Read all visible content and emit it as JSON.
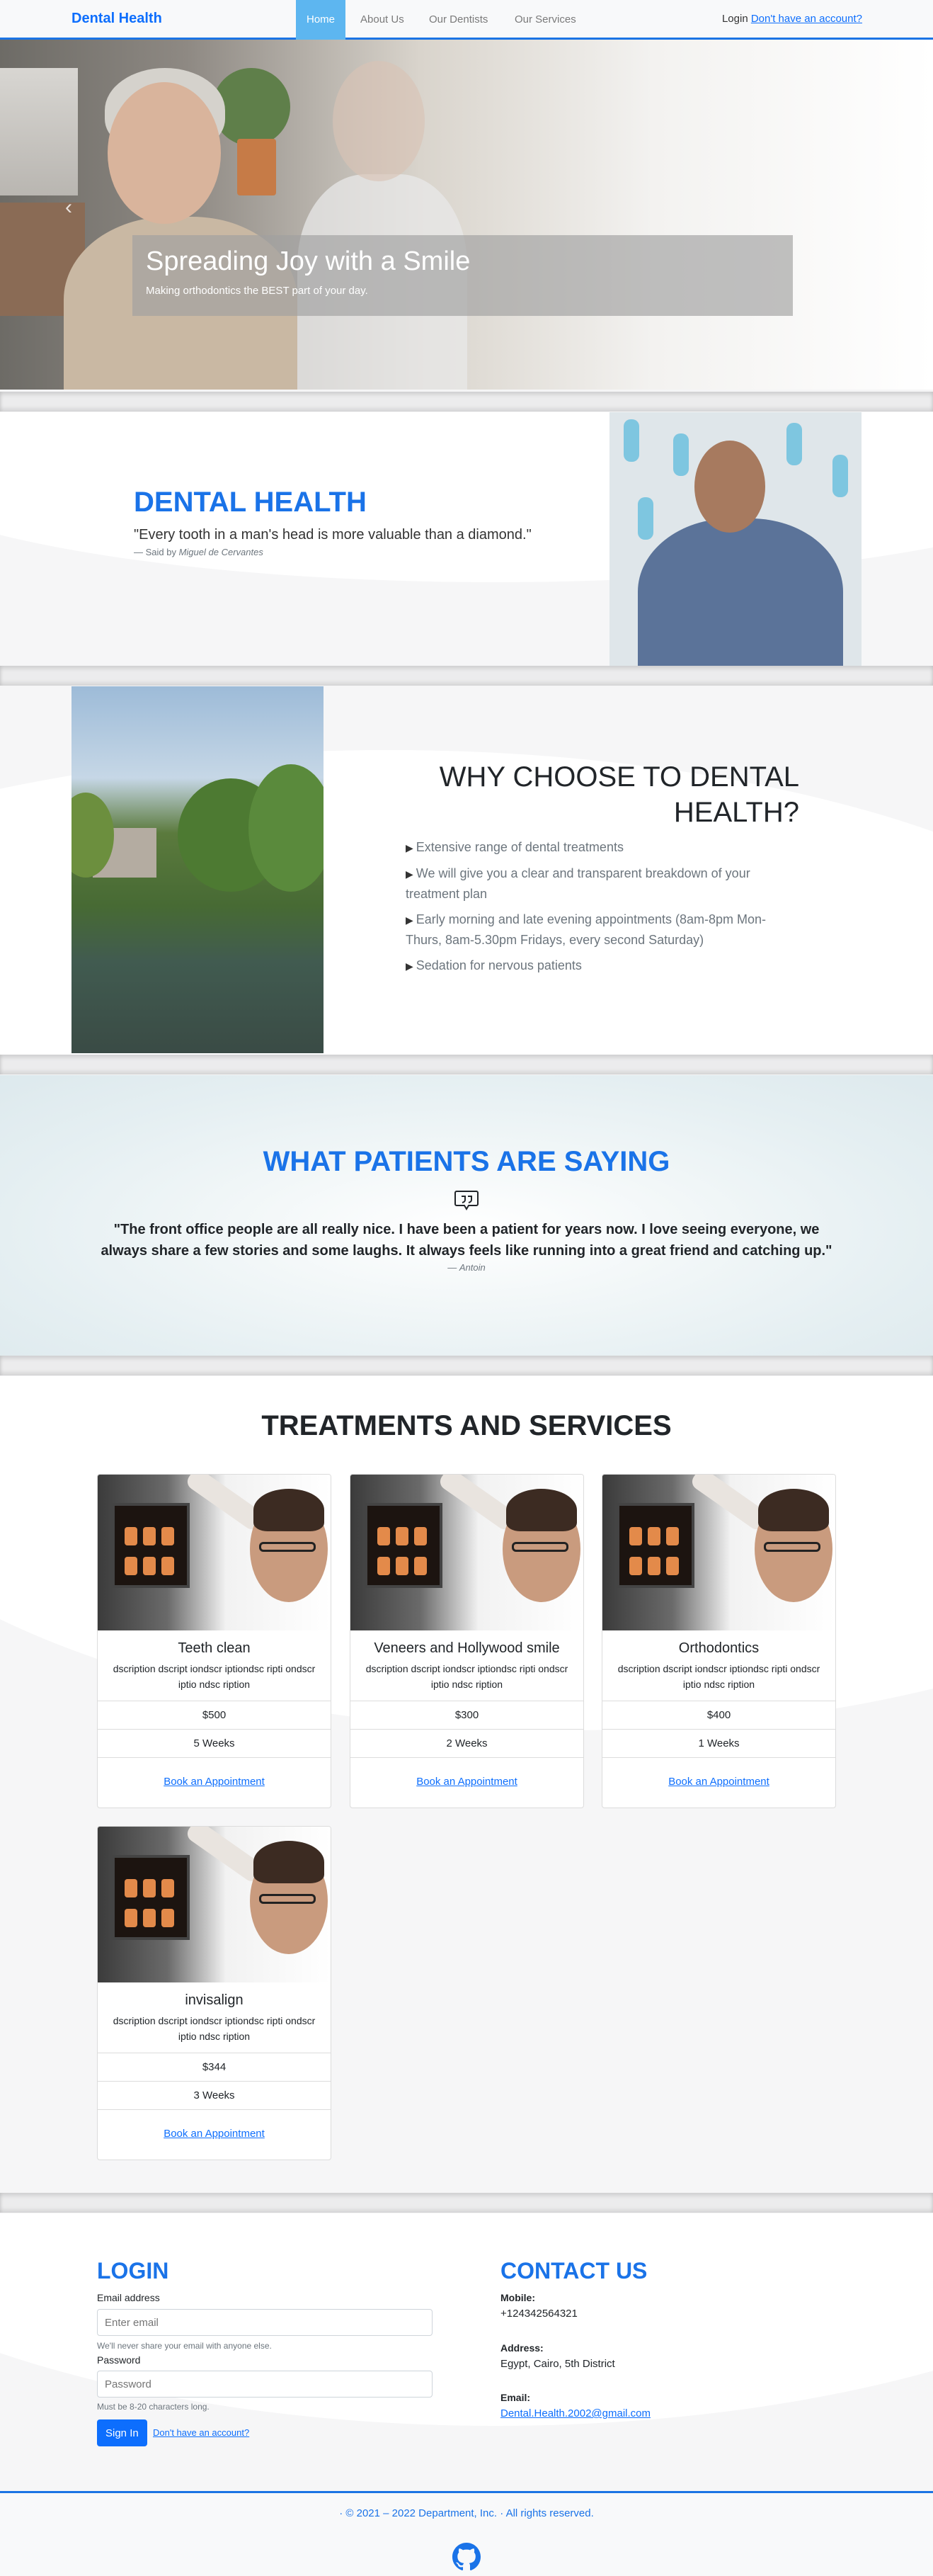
{
  "nav": {
    "brand": "Dental Health",
    "links": [
      "Home",
      "About Us",
      "Our Dentists",
      "Our Services"
    ],
    "login_label": "Login",
    "signup_link": "Don't have an account?"
  },
  "hero": {
    "title": "Spreading Joy with a Smile",
    "subtitle": "Making orthodontics the BEST part of your day."
  },
  "about": {
    "title": "DENTAL HEALTH",
    "quote": "\"Every tooth in a man's head is more valuable than a diamond.\"",
    "said_prefix": "— Said by ",
    "author": "Miguel de Cervantes"
  },
  "why": {
    "title": "WHY CHOOSE TO DENTAL HEALTH?",
    "items": [
      "Extensive range of dental treatments",
      "We will give you a clear and transparent breakdown of your treatment plan",
      "Early morning and late evening appointments (8am-8pm Mon-Thurs, 8am-5.30pm Fridays, every second Saturday)",
      "Sedation for nervous patients"
    ]
  },
  "testimonial": {
    "title": "WHAT PATIENTS ARE SAYING",
    "quote": "\"The front office people are all really nice. I have been a patient for years now. I love seeing everyone, we always share a few stories and some laughs. It always feels like running into a great friend and catching up.\"",
    "author_prefix": "— ",
    "author": "Antoin"
  },
  "treatments": {
    "title": "TREATMENTS AND SERVICES",
    "cards": [
      {
        "name": "Teeth clean",
        "desc": "dscription dscript iondscr iptiondsc ripti ondscr iptio ndsc ription",
        "price": "$500",
        "duration": "5 Weeks",
        "cta": "Book an Appointment"
      },
      {
        "name": "Veneers and Hollywood smile",
        "desc": "dscription dscript iondscr iptiondsc ripti ondscr iptio ndsc ription",
        "price": "$300",
        "duration": "2 Weeks",
        "cta": "Book an Appointment"
      },
      {
        "name": "Orthodontics",
        "desc": "dscription dscript iondscr iptiondsc ripti ondscr iptio ndsc ription",
        "price": "$400",
        "duration": "1 Weeks",
        "cta": "Book an Appointment"
      },
      {
        "name": "invisalign",
        "desc": "dscription dscript iondscr iptiondsc ripti ondscr iptio ndsc ription",
        "price": "$344",
        "duration": "3 Weeks",
        "cta": "Book an Appointment"
      }
    ]
  },
  "login": {
    "title": "LOGIN",
    "email_label": "Email address",
    "email_placeholder": "Enter email",
    "email_help": "We'll never share your email with anyone else.",
    "password_label": "Password",
    "password_placeholder": "Password",
    "password_help": "Must be 8-20 characters long.",
    "signin_label": "Sign In",
    "signup_link": "Don't have an account?"
  },
  "contact": {
    "title": "CONTACT US",
    "mobile_label": "Mobile:",
    "mobile": "+124342564321",
    "address_label": "Address:",
    "address": "Egypt, Cairo, 5th District",
    "email_label": "Email:",
    "email": "Dental.Health.2002@gmail.com"
  },
  "footer": {
    "copyright": "· © 2021 – 2022 Department, Inc. · All rights reserved."
  },
  "colors": {
    "accent": "#1a73e8",
    "nav_active": "#5db6f0",
    "primary_button": "#0d6efd"
  }
}
